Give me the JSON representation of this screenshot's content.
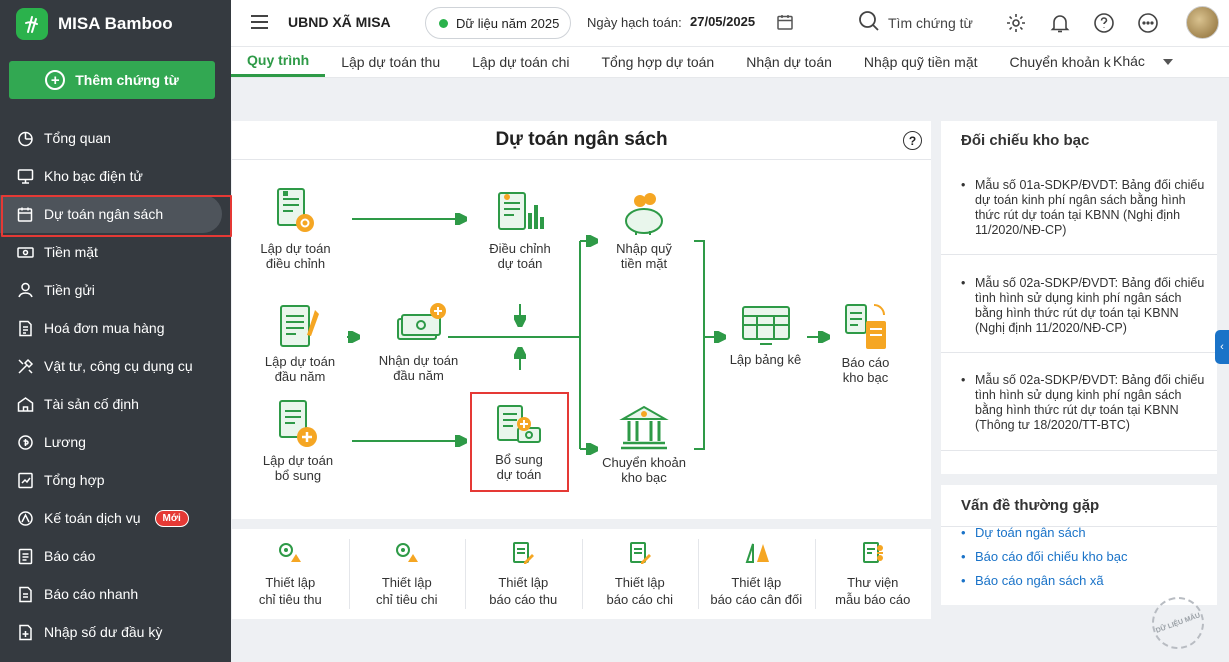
{
  "app": {
    "name": "MISA Bamboo"
  },
  "sidebar": {
    "add_button": "Thêm chứng từ",
    "items": [
      {
        "label": "Tổng quan",
        "icon": "pie-chart-icon"
      },
      {
        "label": "Kho bạc điện tử",
        "icon": "monitor-icon"
      },
      {
        "label": "Dự toán ngân sách",
        "icon": "budget-icon"
      },
      {
        "label": "Tiền mặt",
        "icon": "cash-icon"
      },
      {
        "label": "Tiền gửi",
        "icon": "deposit-icon"
      },
      {
        "label": "Hoá đơn mua hàng",
        "icon": "invoice-icon"
      },
      {
        "label": "Vật tư, công cụ dụng cụ",
        "icon": "tools-icon"
      },
      {
        "label": "Tài sản cố định",
        "icon": "building-icon"
      },
      {
        "label": "Lương",
        "icon": "salary-icon"
      },
      {
        "label": "Tổng hợp",
        "icon": "summary-icon"
      },
      {
        "label": "Kế toán dịch vụ",
        "icon": "service-icon",
        "badge": "Mới"
      },
      {
        "label": "Báo cáo",
        "icon": "report-icon"
      },
      {
        "label": "Báo cáo nhanh",
        "icon": "quick-report-icon"
      },
      {
        "label": "Nhập số dư đầu kỳ",
        "icon": "opening-balance-icon"
      }
    ]
  },
  "header": {
    "org": "UBND XÃ MISA",
    "data_year": "Dữ liệu năm 2025",
    "posting_date_label": "Ngày hạch toán:",
    "posting_date": "27/05/2025",
    "search_placeholder": "Tìm chứng từ"
  },
  "tabs": [
    "Quy trình",
    "Lập dự toán thu",
    "Lập dự toán chi",
    "Tổng hợp dự toán",
    "Nhận dự toán",
    "Nhập quỹ tiền mặt",
    "Chuyển khoản k"
  ],
  "tabs_more": "Khác",
  "flow": {
    "title": "Dự toán ngân sách",
    "nodes": {
      "lap_dieu_chinh": [
        "Lập dự toán",
        "điều chỉnh"
      ],
      "dieu_chinh": [
        "Điều chỉnh",
        "dự toán"
      ],
      "nhap_quy": [
        "Nhập quỹ",
        "tiền mặt"
      ],
      "lap_dau_nam": [
        "Lập dự toán",
        "đầu năm"
      ],
      "nhan_dau_nam": [
        "Nhận dự toán",
        "đầu năm"
      ],
      "lap_bang_ke": [
        "Lập bảng kê"
      ],
      "bao_cao_kho_bac": [
        "Báo cáo",
        "kho bạc"
      ],
      "lap_bo_sung": [
        "Lập dự toán",
        "bổ sung"
      ],
      "bo_sung": [
        "Bổ sung",
        "dự toán"
      ],
      "chuyen_khoan": [
        "Chuyển khoản",
        "kho bạc"
      ]
    }
  },
  "shortcuts": [
    [
      "Thiết lập",
      "chỉ tiêu thu"
    ],
    [
      "Thiết lập",
      "chỉ tiêu chi"
    ],
    [
      "Thiết lập",
      "báo cáo thu"
    ],
    [
      "Thiết lập",
      "báo cáo chi"
    ],
    [
      "Thiết lập",
      "báo cáo cân đối"
    ],
    [
      "Thư viện",
      "mẫu báo cáo"
    ]
  ],
  "reconcile": {
    "title": "Đối chiếu kho bạc",
    "items": [
      "Mẫu số 01a-SDKP/ĐVDT: Bảng đối chiếu dự toán kinh phí ngân sách bằng hình thức rút dự toán tại KBNN (Nghị định 11/2020/NĐ-CP)",
      "Mẫu số 02a-SDKP/ĐVDT: Bảng đối chiếu tình hình sử dụng kinh phí ngân sách bằng hình thức rút dự toán tại KBNN (Nghị định 11/2020/NĐ-CP)",
      "Mẫu số 02a-SDKP/ĐVDT: Bảng đối chiếu tình hình sử dụng kinh phí ngân sách bằng hình thức rút dự toán tại KBNN (Thông tư 18/2020/TT-BTC)"
    ]
  },
  "faq": {
    "title": "Vấn đề thường gặp",
    "links": [
      "Dự toán ngân sách",
      "Báo cáo đối chiếu kho bạc",
      "Báo cáo ngân sách xã"
    ]
  },
  "watermark": "DỮ LIỆU MẪU",
  "colors": {
    "sidebar": "#353a40",
    "accent_green": "#2e9a47",
    "highlight_red": "#e53935",
    "link_blue": "#1a73c8",
    "icon_orange": "#f5a623"
  }
}
